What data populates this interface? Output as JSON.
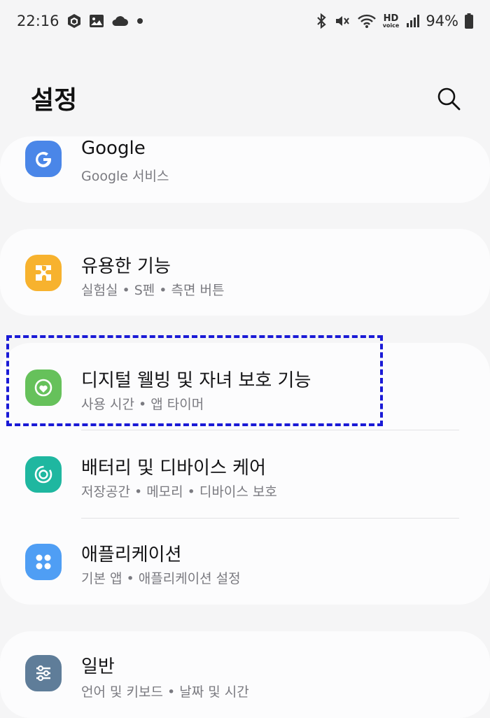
{
  "status_bar": {
    "time": "22:16",
    "battery": "94%",
    "hd_voice_top": "HD",
    "hd_voice_bottom": "voice"
  },
  "header": {
    "title": "설정"
  },
  "cards": [
    {
      "items": [
        {
          "label": "Google",
          "subtitle": "Google 서비스",
          "icon": "google-icon",
          "color": "#4a86e8"
        }
      ]
    },
    {
      "items": [
        {
          "label": "유용한 기능",
          "subtitle": "실험실 • S펜 • 측면 버튼",
          "icon": "puzzle-icon",
          "color": "#f7b22e"
        }
      ]
    },
    {
      "items": [
        {
          "label": "디지털 웰빙 및 자녀 보호 기능",
          "subtitle": "사용 시간 • 앱 타이머",
          "icon": "wellbeing-icon",
          "color": "#66c15b"
        },
        {
          "label": "배터리 및 디바이스 케어",
          "subtitle": "저장공간 • 메모리 • 디바이스 보호",
          "icon": "device-care-icon",
          "color": "#1fb7a0"
        },
        {
          "label": "애플리케이션",
          "subtitle": "기본 앱 • 애플리케이션 설정",
          "icon": "apps-icon",
          "color": "#4f9ef4"
        }
      ]
    },
    {
      "items": [
        {
          "label": "일반",
          "subtitle": "언어 및 키보드 • 날짜 및 시간",
          "icon": "sliders-icon",
          "color": "#5f7d99"
        }
      ]
    }
  ],
  "colors": {
    "background": "#f5f5f6",
    "card": "#fcfcfd",
    "highlight_box": "#1a1ad6"
  }
}
